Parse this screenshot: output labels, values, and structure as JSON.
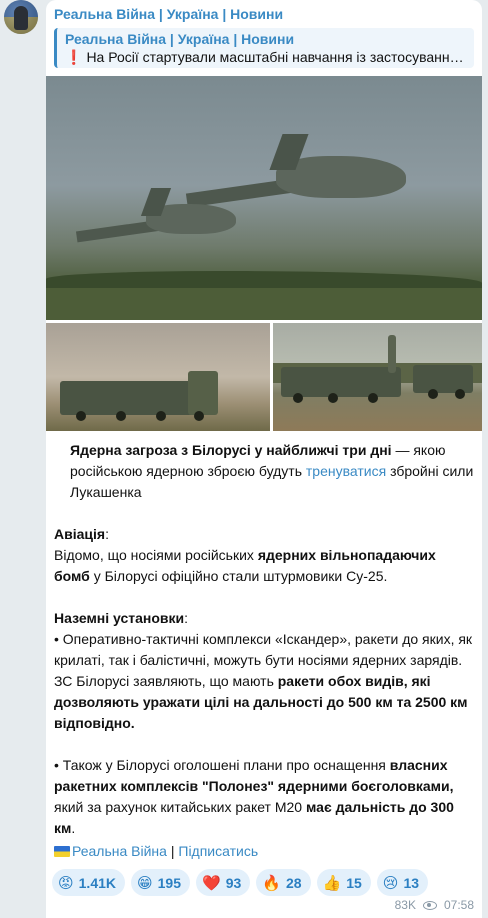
{
  "channel": {
    "name": "Реальна Війна | Україна | Новини"
  },
  "reply": {
    "title": "Реальна Війна | Україна | Новини",
    "icon": "❗",
    "text": "На Росії стартували масштабні навчання із застосування…"
  },
  "post": {
    "lead_bold": "Ядерна загроза з Білорусі у найближчі три дні",
    "lead_rest_1": " — якою російською ядерною зброєю будуть ",
    "lead_link": "тренуватися",
    "lead_rest_2": " збройні сили Лукашенка",
    "aviation_heading": "Авіація",
    "aviation_colon": ":",
    "aviation_text_1": "Відомо, що носіями російських ",
    "aviation_bold": "ядерних вільнопадаючих бомб",
    "aviation_text_2": " у Білорусі офіційно стали штурмовики Су-25.",
    "ground_heading": "Наземні установки",
    "ground_colon": ":",
    "bullet1_text_1": "• Оперативно-тактичні комплекси «Іскандер», ракети до яких, як крилаті, так і балістичні, можуть бути носіями ядерних зарядів. ЗС Білорусі заявляють, що мають ",
    "bullet1_bold": "ракети обох видів, які дозволяють уражати цілі на дальності до 500 км та 2500 км відповідно.",
    "bullet2_text_1": "• Також у Білорусі оголошені плани про оснащення ",
    "bullet2_bold_1": "власних ракетних комплексів \"Полонез\" ядерними боєголовками,",
    "bullet2_text_2": " який за рахунок китайських ракет М20 ",
    "bullet2_bold_2": "має дальність до 300 км",
    "bullet2_text_3": "."
  },
  "footer": {
    "channel_link": "Реальна Війна",
    "separator": " | ",
    "subscribe_link": "Підписатись"
  },
  "reactions": [
    {
      "emoji": "😡",
      "count": "1.41K"
    },
    {
      "emoji": "😁",
      "count": "195"
    },
    {
      "emoji": "❤️",
      "count": "93"
    },
    {
      "emoji": "🔥",
      "count": "28"
    },
    {
      "emoji": "👍",
      "count": "15"
    },
    {
      "emoji": "😢",
      "count": "13"
    }
  ],
  "meta": {
    "views": "83K",
    "time": "07:58"
  },
  "colors": {
    "accent": "#3a8ac4",
    "reaction_bg": "#e3f0fb",
    "background": "#e6ebee"
  }
}
